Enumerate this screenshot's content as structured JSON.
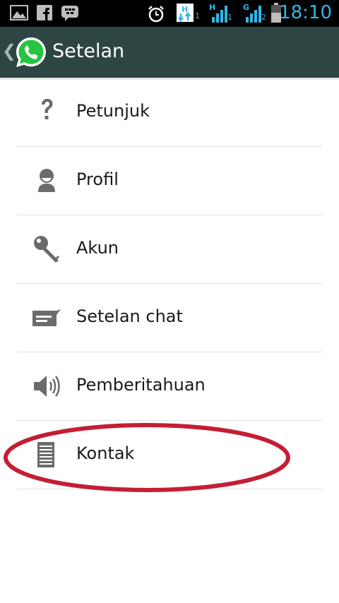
{
  "status_bar": {
    "time": "18:10",
    "sim1_label": "H",
    "sim1_index": "1",
    "sim2_label": "G",
    "sim2_index": "2",
    "data_indicator_label": "H",
    "data_indicator_index": "1",
    "icons": [
      "gallery-icon",
      "facebook-icon",
      "bbm-icon",
      "alarm-icon",
      "data-transfer-icon",
      "signal-icon",
      "battery-icon"
    ]
  },
  "action_bar": {
    "title": "Setelan",
    "color": "#2d4543"
  },
  "menu": {
    "items": [
      {
        "label": "Petunjuk",
        "icon": "help-icon"
      },
      {
        "label": "Profil",
        "icon": "profile-icon"
      },
      {
        "label": "Akun",
        "icon": "key-icon"
      },
      {
        "label": "Setelan chat",
        "icon": "chat-icon"
      },
      {
        "label": "Pemberitahuan",
        "icon": "speaker-icon"
      },
      {
        "label": "Kontak",
        "icon": "contacts-icon"
      }
    ]
  },
  "annotation": {
    "highlight_color": "#c41e35"
  }
}
